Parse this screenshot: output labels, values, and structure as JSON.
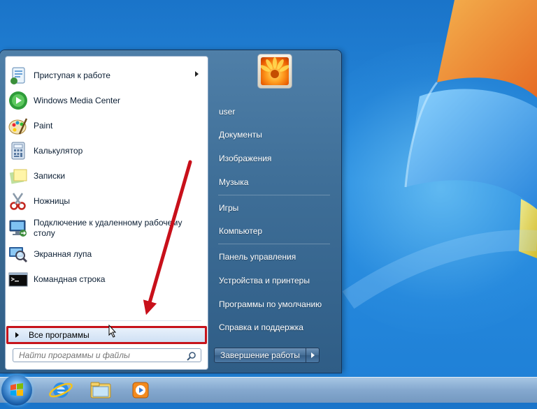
{
  "start_menu": {
    "programs": [
      {
        "label": "Приступая к работе",
        "icon": "getting-started-icon",
        "has_submenu": true
      },
      {
        "label": "Windows Media Center",
        "icon": "media-center-icon"
      },
      {
        "label": "Paint",
        "icon": "paint-icon"
      },
      {
        "label": "Калькулятор",
        "icon": "calculator-icon"
      },
      {
        "label": "Записки",
        "icon": "sticky-notes-icon"
      },
      {
        "label": "Ножницы",
        "icon": "snipping-tool-icon"
      },
      {
        "label": "Подключение к удаленному рабочему столу",
        "icon": "remote-desktop-icon"
      },
      {
        "label": "Экранная лупа",
        "icon": "magnifier-icon"
      },
      {
        "label": "Командная строка",
        "icon": "cmd-icon"
      }
    ],
    "all_programs_label": "Все программы",
    "search_placeholder": "Найти программы и файлы",
    "right_items": {
      "user": "user",
      "documents": "Документы",
      "pictures": "Изображения",
      "music": "Музыка",
      "games": "Игры",
      "computer": "Компьютер",
      "control_panel": "Панель управления",
      "devices": "Устройства и принтеры",
      "default_programs": "Программы по умолчанию",
      "help": "Справка и поддержка"
    },
    "shutdown_label": "Завершение работы"
  },
  "taskbar": {
    "pinned": [
      "internet-explorer-icon",
      "explorer-folder-icon",
      "media-player-icon"
    ]
  },
  "colors": {
    "highlight_border": "#c6131b",
    "annotation_arrow": "#c8101a"
  }
}
